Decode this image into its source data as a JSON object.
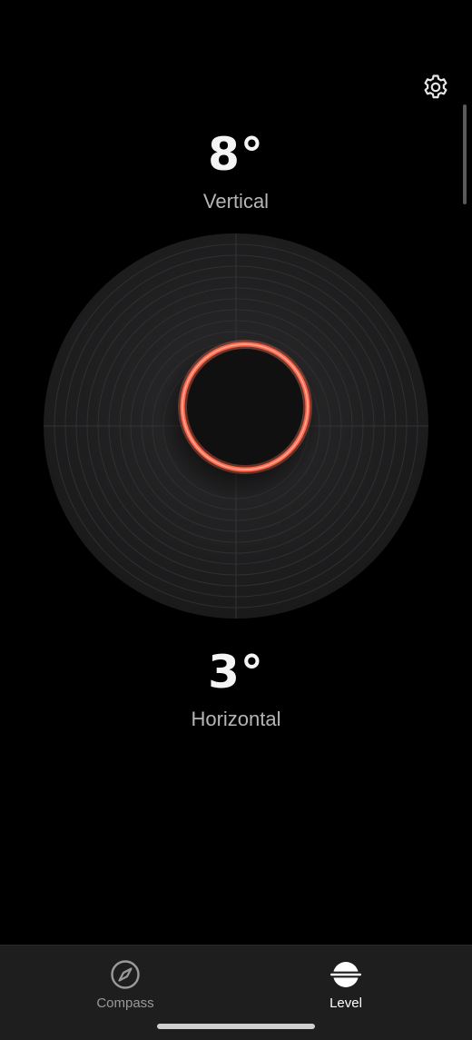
{
  "readings": {
    "vertical": {
      "value": "8°",
      "label": "Vertical"
    },
    "horizontal": {
      "value": "3°",
      "label": "Horizontal"
    }
  },
  "level_indicator": {
    "bubble_color": "#ff6a4d",
    "disc_color": "#1c1c1e"
  },
  "toolbar": {
    "settings_icon": "gear-icon"
  },
  "bottom_nav": {
    "items": [
      {
        "label": "Compass",
        "icon": "compass-icon",
        "selected": false
      },
      {
        "label": "Level",
        "icon": "level-icon",
        "selected": true
      }
    ]
  }
}
